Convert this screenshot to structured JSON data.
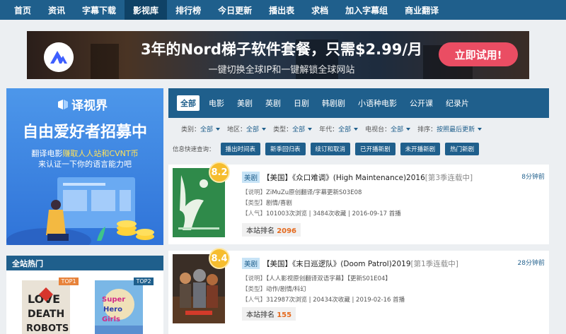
{
  "nav": {
    "items": [
      "首页",
      "资讯",
      "字幕下载",
      "影视库",
      "排行榜",
      "今日更新",
      "播出表",
      "求档",
      "加入字幕组",
      "商业翻译"
    ],
    "active_index": 3
  },
  "ad": {
    "headline": "3年的Nord梯子软件套餐，只需$2.99/月",
    "subline": "一键切换全球IP和一键解锁全球网站",
    "cta": "立即试用!"
  },
  "promo": {
    "brand": "译视界",
    "headline": "自由爱好者招募中",
    "line1_pre": "翻译电影",
    "line1_highlight": "赚取人人站和CVNT币",
    "line2": "来认证一下你的语言能力吧"
  },
  "hot": {
    "title": "全站热门",
    "tags": [
      "TOP1",
      "TOP2"
    ]
  },
  "categories": {
    "items": [
      "全部",
      "电影",
      "美剧",
      "英剧",
      "日剧",
      "韩剧剧",
      "小语种电影",
      "公开课",
      "纪录片"
    ],
    "active_index": 0
  },
  "filters": [
    {
      "label": "类别：",
      "value": "全部"
    },
    {
      "label": "地区：",
      "value": "全部"
    },
    {
      "label": "类型：",
      "value": "全部"
    },
    {
      "label": "年代：",
      "value": "全部"
    },
    {
      "label": "电视台：",
      "value": "全部"
    },
    {
      "label": "排序：",
      "value": "按照最后更新"
    }
  ],
  "quick": {
    "label": "信息快速查询：",
    "buttons": [
      "播出时间表",
      "新季回归表",
      "续订和取消",
      "已开播新剧",
      "未开播新剧",
      "热门新剧"
    ]
  },
  "shows": [
    {
      "score": "8.2",
      "type": "美剧",
      "title": "【美国】《众口难调》(High Maintenance)2016",
      "status": "[第3季连载中]",
      "time": "8分钟前",
      "desc_label": "【说明】",
      "desc": "ZiMuZu原创翻译/字幕更新S03E08",
      "genre_label": "【类型】",
      "genre": "剧情/喜剧",
      "pop_label": "【人气】",
      "pop": "101003次浏览 | 3484次收藏 | 2016-09-17 首播",
      "rank_label": "本站排名",
      "rank": "2096"
    },
    {
      "score": "8.4",
      "type": "美剧",
      "title": "【美国】《末日巡逻队》(Doom Patrol)2019",
      "status": "[第1季连载中]",
      "time": "28分钟前",
      "desc_label": "【说明】",
      "desc": "【人人影视原创翻译双语字幕】【更新S01E04】",
      "genre_label": "【类型】",
      "genre": "动作/剧情/科幻",
      "pop_label": "【人气】",
      "pop": "312987次浏览 | 20434次收藏 | 2019-02-16 首播",
      "rank_label": "本站排名",
      "rank": "155"
    }
  ],
  "colors": {
    "nav": "#1f5f8c",
    "nav_active": "#0f4266",
    "score": "#f6bd2e",
    "rank": "#e56a1e",
    "cta": "#ea4d63"
  }
}
